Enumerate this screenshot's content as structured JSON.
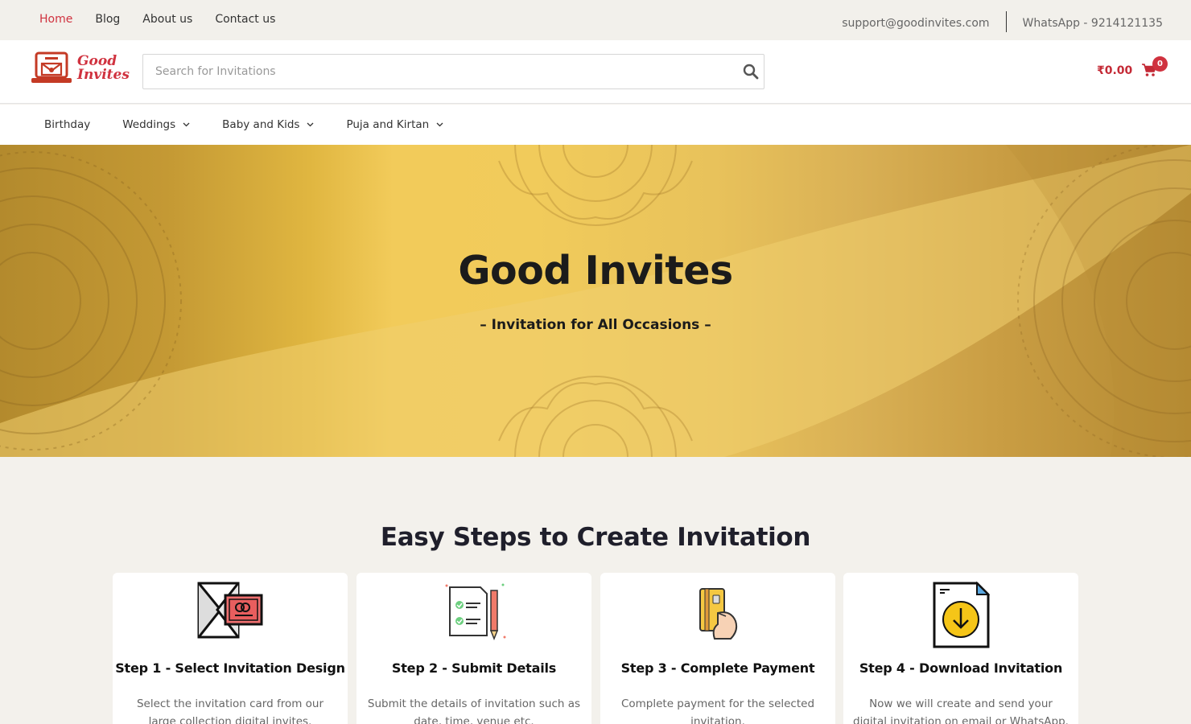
{
  "topbar": {
    "nav": [
      "Home",
      "Blog",
      "About us",
      "Contact us"
    ],
    "email": "support@goodinvites.com",
    "whatsapp": "WhatsApp - 9214121135"
  },
  "header": {
    "logo_line1": "Good",
    "logo_line2": "Invites",
    "search_placeholder": "Search for Invitations",
    "cart_amount": "₹0.00",
    "cart_count": "0"
  },
  "mainnav": [
    "Birthday",
    "Weddings",
    "Baby and Kids",
    "Puja and Kirtan"
  ],
  "hero": {
    "title": "Good Invites",
    "subtitle": "– Invitation for All Occasions –"
  },
  "steps": {
    "title": "Easy Steps to Create Invitation",
    "items": [
      {
        "title": "Step 1 - Select Invitation Design",
        "text": "Select the invitation card from our large collection digital invites."
      },
      {
        "title": "Step 2 - Submit Details",
        "text": "Submit the details of invitation such as date, time, venue etc."
      },
      {
        "title": "Step 3 - Complete Payment",
        "text": "Complete payment for the selected invitation."
      },
      {
        "title": "Step 4 - Download Invitation",
        "text": "Now we will create and send your digital invitation on email or WhatsApp."
      }
    ]
  },
  "colors": {
    "accent": "#d0323f",
    "gold": "#f2cb5a"
  }
}
